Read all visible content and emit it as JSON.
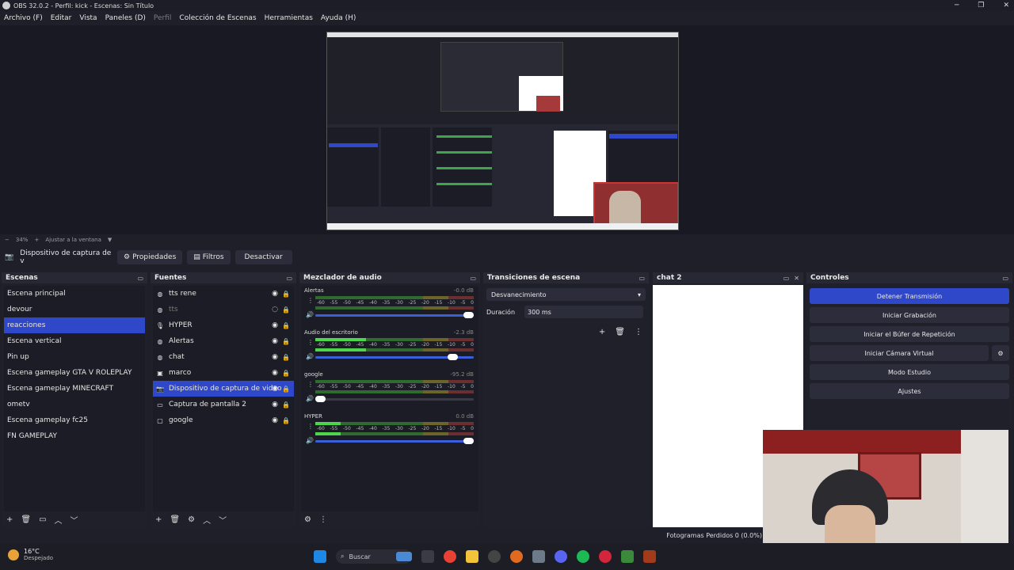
{
  "window": {
    "title": "OBS 32.0.2 - Perfil: kick - Escenas: Sin Título",
    "minimize": "─",
    "maximize": "❐",
    "close": "✕"
  },
  "menu": [
    "Archivo (F)",
    "Editar",
    "Vista",
    "Paneles (D)",
    "Perfil",
    "Colección de Escenas",
    "Herramientas",
    "Ayuda (H)"
  ],
  "zoom": {
    "minus": "−",
    "value": "34%",
    "plus": "+",
    "fit": "Ajustar a la ventana"
  },
  "source_toolbar": {
    "name": "Dispositivo de captura de v",
    "properties": "Propiedades",
    "filters": "Filtros",
    "deactivate": "Desactivar"
  },
  "scenes": {
    "title": "Escenas",
    "items": [
      "Escena principal",
      "devour",
      "reacciones",
      "Escena vertical",
      "Pin up",
      "Escena gameplay GTA V ROLEPLAY",
      "Escena gameplay MINECRAFT",
      "ometv",
      "Escena gameplay fc25",
      "FN GAMEPLAY"
    ],
    "selected": 2
  },
  "sources": {
    "title": "Fuentes",
    "items": [
      {
        "label": "tts rene",
        "icon": "browser-icon"
      },
      {
        "label": "tts",
        "icon": "browser-icon"
      },
      {
        "label": "HYPER",
        "icon": "mic-icon"
      },
      {
        "label": "Alertas",
        "icon": "browser-icon"
      },
      {
        "label": "chat",
        "icon": "browser-icon"
      },
      {
        "label": "marco",
        "icon": "image-icon"
      },
      {
        "label": "Dispositivo de captura de video",
        "icon": "camera-icon"
      },
      {
        "label": "Captura de pantalla 2",
        "icon": "monitor-icon"
      },
      {
        "label": "google",
        "icon": "window-icon"
      }
    ],
    "selected": 6
  },
  "mixer": {
    "title": "Mezclador de audio",
    "ticks": [
      "-60",
      "-55",
      "-50",
      "-45",
      "-40",
      "-35",
      "-30",
      "-25",
      "-20",
      "-15",
      "-10",
      "-5",
      "0"
    ],
    "channels": [
      {
        "name": "Alertas",
        "db": "-0.0 dB",
        "level": 0.0,
        "volume": 1.0
      },
      {
        "name": "Audio del escritorio",
        "db": "-2.3 dB",
        "level": 0.32,
        "volume": 0.9
      },
      {
        "name": "google",
        "db": "-95.2 dB",
        "level": 0.0,
        "volume": 0.02
      },
      {
        "name": "HYPER",
        "db": "0.0 dB",
        "level": 0.16,
        "volume": 1.0
      }
    ]
  },
  "transitions": {
    "title": "Transiciones de escena",
    "selected": "Desvanecimiento",
    "duration_label": "Duración",
    "duration_value": "300 ms"
  },
  "chat": {
    "title": "chat 2"
  },
  "controls": {
    "title": "Controles",
    "buttons": [
      "Detener Transmisión",
      "Iniciar Grabación",
      "Iniciar el Búfer de Repetición",
      "Iniciar Cámara Virtual",
      "Modo Estudio",
      "Ajustes"
    ]
  },
  "status": {
    "dropped": "Fotogramas Perdidos 0 (0.0%)"
  },
  "taskbar": {
    "temp": "16°C",
    "weather": "Despejado",
    "search": "Buscar"
  },
  "colors": {
    "accent": "#2f48c9",
    "bg": "#1e1f29"
  }
}
